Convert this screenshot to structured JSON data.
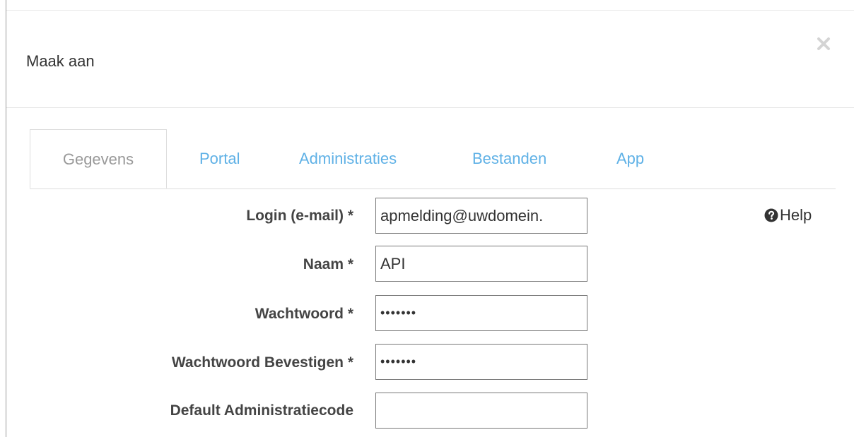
{
  "modal": {
    "title": "Maak aan",
    "close_label": "×"
  },
  "tabs": [
    {
      "label": "Gegevens",
      "active": true
    },
    {
      "label": "Portal",
      "active": false
    },
    {
      "label": "Administraties",
      "active": false
    },
    {
      "label": "Bestanden",
      "active": false
    },
    {
      "label": "App",
      "active": false
    }
  ],
  "help": {
    "label": "Help",
    "icon": "question-circle-icon"
  },
  "form": {
    "fields": [
      {
        "label": "Login (e-mail) *",
        "value": "apmelding@uwdomein.",
        "type": "email"
      },
      {
        "label": "Naam *",
        "value": "API",
        "type": "text"
      },
      {
        "label": "Wachtwoord *",
        "value": "•••••••",
        "type": "password"
      },
      {
        "label": "Wachtwoord Bevestigen *",
        "value": "•••••••",
        "type": "password"
      },
      {
        "label": "Default Administratiecode",
        "value": "",
        "type": "text"
      }
    ]
  },
  "colors": {
    "tab_link": "#5fb1e6",
    "tab_active": "#999999",
    "border": "#dddddd"
  }
}
